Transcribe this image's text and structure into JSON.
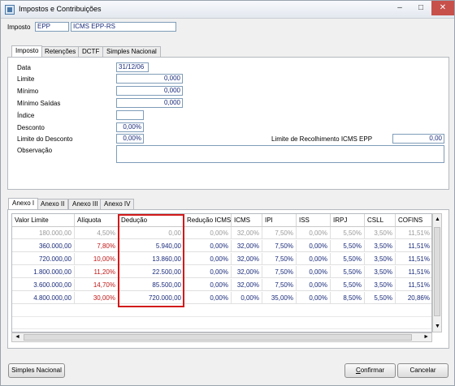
{
  "window": {
    "title": "Impostos e Contribuições",
    "min": "–",
    "max": "□",
    "close": "✕"
  },
  "imposto": {
    "label": "Imposto",
    "code": "EPP",
    "description": "ICMS EPP-RS"
  },
  "tabs": [
    "Imposto",
    "Retenções",
    "DCTF",
    "Simples Nacional"
  ],
  "form": {
    "data_label": "Data",
    "data_value": "31/12/06",
    "limite_label": "Limite",
    "limite_value": "0,000",
    "minimo_label": "Mínimo",
    "minimo_value": "0,000",
    "minimo_saidas_label": "Mínimo Saídas",
    "minimo_saidas_value": "0,000",
    "indice_label": "Índice",
    "indice_value": "",
    "desconto_label": "Desconto",
    "desconto_value": "0,00%",
    "limite_desconto_label": "Limite do Desconto",
    "limite_desconto_value": "0,00%",
    "limite_recolhimento_label": "Limite de Recolhimento ICMS EPP",
    "limite_recolhimento_value": "0,00",
    "observacao_label": "Observação",
    "observacao_value": ""
  },
  "anexo_tabs": [
    "Anexo I",
    "Anexo II",
    "Anexo III",
    "Anexo IV"
  ],
  "grid": {
    "columns": [
      "Valor Limite",
      "Alíquota",
      "Dedução",
      "Redução ICMS",
      "ICMS",
      "IPI",
      "ISS",
      "IRPJ",
      "CSLL",
      "COFINS"
    ],
    "rows": [
      [
        "180.000,00",
        "4,50%",
        "0,00",
        "0,00%",
        "32,00%",
        "7,50%",
        "0,00%",
        "5,50%",
        "3,50%",
        "11,51%"
      ],
      [
        "360.000,00",
        "7,80%",
        "5.940,00",
        "0,00%",
        "32,00%",
        "7,50%",
        "0,00%",
        "5,50%",
        "3,50%",
        "11,51%"
      ],
      [
        "720.000,00",
        "10,00%",
        "13.860,00",
        "0,00%",
        "32,00%",
        "7,50%",
        "0,00%",
        "5,50%",
        "3,50%",
        "11,51%"
      ],
      [
        "1.800.000,00",
        "11,20%",
        "22.500,00",
        "0,00%",
        "32,00%",
        "7,50%",
        "0,00%",
        "5,50%",
        "3,50%",
        "11,51%"
      ],
      [
        "3.600.000,00",
        "14,70%",
        "85.500,00",
        "0,00%",
        "32,00%",
        "7,50%",
        "0,00%",
        "5,50%",
        "3,50%",
        "11,51%"
      ],
      [
        "4.800.000,00",
        "30,00%",
        "720.000,00",
        "0,00%",
        "0,00%",
        "35,00%",
        "0,00%",
        "8,50%",
        "5,50%",
        "20,86%"
      ]
    ]
  },
  "scroll": {
    "up": "▲",
    "down": "▼",
    "left": "◄",
    "right": "►"
  },
  "buttons": {
    "simples_nacional": "Simples Nacional",
    "confirmar_prefix": "C",
    "confirmar_rest": "onfirmar",
    "cancelar": "Cancelar"
  },
  "colors": {
    "navy": "#1a2b7a",
    "red": "#c01818",
    "highlight": "#d21a1a"
  }
}
